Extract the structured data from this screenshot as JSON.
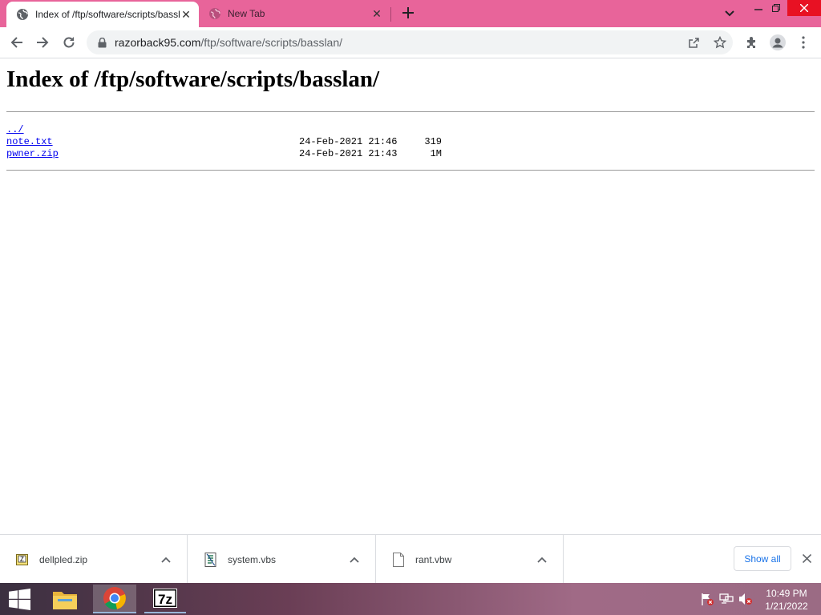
{
  "browser": {
    "tabs": [
      {
        "title": "Index of /ftp/software/scripts/basslan/",
        "active": true
      },
      {
        "title": "New Tab",
        "active": false
      }
    ],
    "url": {
      "host": "razorback95.com",
      "path": "/ftp/software/scripts/basslan/"
    }
  },
  "page": {
    "heading": "Index of /ftp/software/scripts/basslan/",
    "entries": [
      {
        "name": "../",
        "date": "",
        "size": ""
      },
      {
        "name": "note.txt",
        "date": "24-Feb-2021 21:46",
        "size": "319"
      },
      {
        "name": "pwner.zip",
        "date": "24-Feb-2021 21:43",
        "size": "1M"
      }
    ]
  },
  "downloads": {
    "items": [
      {
        "name": "dellpled.zip",
        "icon": "zip-file-icon"
      },
      {
        "name": "system.vbs",
        "icon": "script-file-icon"
      },
      {
        "name": "rant.vbw",
        "icon": "blank-file-icon"
      }
    ],
    "show_all": "Show all"
  },
  "taskbar": {
    "apps": [
      "file-explorer-icon",
      "chrome-icon",
      "7zip-icon"
    ],
    "time": "10:49 PM",
    "date": "1/21/2022"
  },
  "colors": {
    "tab_strip": "#e8649a",
    "link": "#0000ee",
    "accent": "#1a73e8"
  }
}
